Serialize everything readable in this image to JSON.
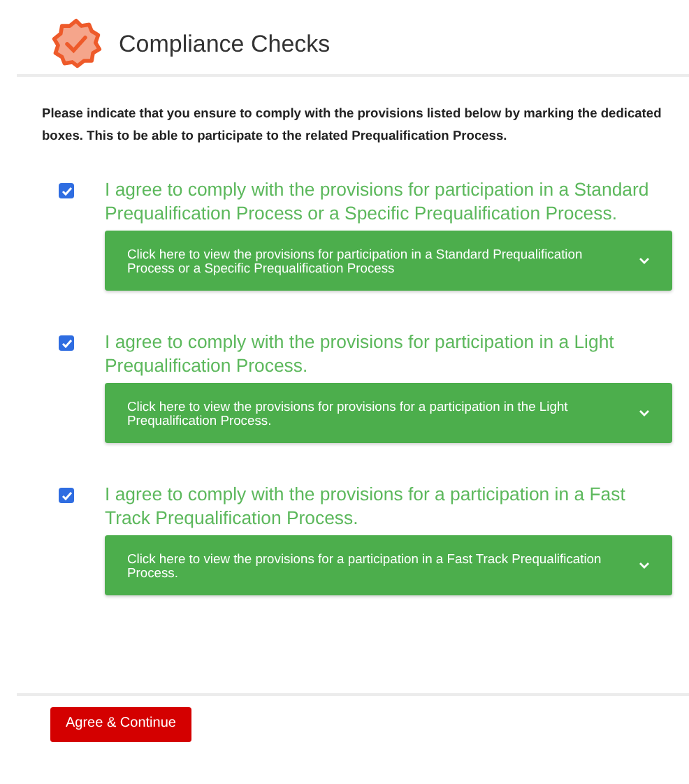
{
  "header": {
    "title": "Compliance Checks"
  },
  "intro": "Please indicate that you ensure to comply with the provisions listed below by marking the dedicated boxes. This to be able to participate to the related Prequalification Process.",
  "items": [
    {
      "label": "I agree to comply with the provisions for participation in a Standard Prequalification Process or a Specific Prequalification Process.",
      "checked": true,
      "panel": "Click here to view the provisions for participation in a Standard Prequalification Process or a Specific Prequalification Process",
      "expanded": false
    },
    {
      "label": "I agree to comply with the provisions for participation in a Light Prequalification Process.",
      "checked": true,
      "panel": "Click here to view the provisions for provisions for a participation in the Light Prequalification Process.",
      "expanded": false
    },
    {
      "label": "I agree to comply with the provisions for a participation in a Fast Track Prequalification Process.",
      "checked": true,
      "panel": "Click here to view the provisions for a participation in a Fast Track Prequalification Process.",
      "expanded": false
    }
  ],
  "button": "Agree & Continue"
}
